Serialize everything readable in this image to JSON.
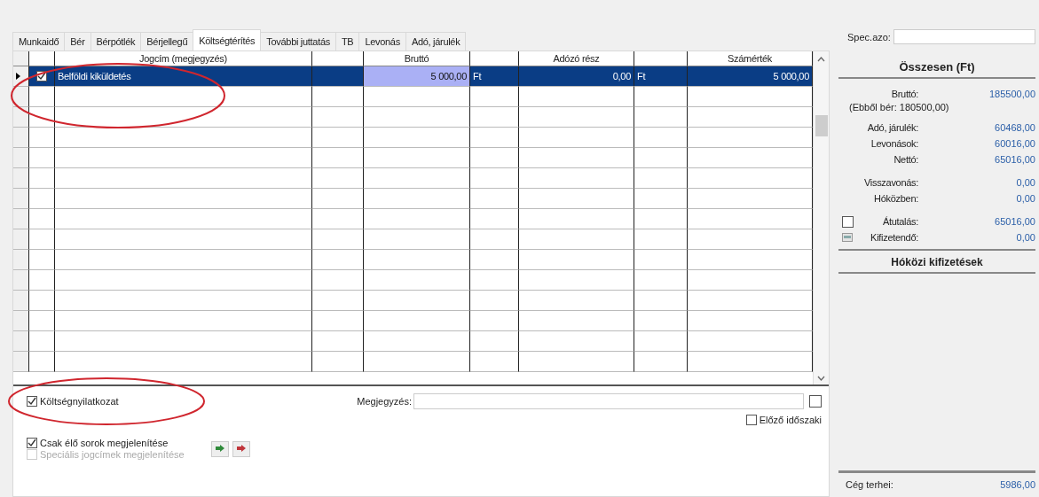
{
  "tabs": [
    {
      "label": "Munkaidő",
      "selected": false
    },
    {
      "label": "Bér",
      "selected": false
    },
    {
      "label": "Bérpótlék",
      "selected": false
    },
    {
      "label": "Bérjellegű",
      "selected": false
    },
    {
      "label": "Költségtérítés",
      "selected": true
    },
    {
      "label": "További juttatás",
      "selected": false
    },
    {
      "label": "TB",
      "selected": false
    },
    {
      "label": "Levonás",
      "selected": false
    },
    {
      "label": "Adó, járulék",
      "selected": false
    }
  ],
  "grid": {
    "header": {
      "jogcim": "Jogcím (megjegyzés)",
      "brutto": "Bruttó",
      "adozo": "Adózó rész",
      "szamertek": "Számérték"
    },
    "rows": [
      {
        "selected": true,
        "checked": true,
        "jogcim": "Belföldi kiküldetés",
        "brutto": "5 000,00",
        "brutto_unit": "Ft",
        "adozo": "0,00",
        "adozo_unit": "Ft",
        "szamertek": "5 000,00",
        "brutto_focused": true
      }
    ]
  },
  "options": {
    "koltsegnyilatkozat": {
      "label": "Költségnyilatkozat",
      "checked": true
    },
    "megjegyzes": {
      "label": "Megjegyzés:",
      "checked": false
    },
    "elozo": {
      "label": "Előző időszaki",
      "checked": false
    },
    "csak_elo": {
      "label": "Csak élő sorok megjelenítése",
      "checked": true
    },
    "specialis": {
      "label": "Speciális jogcímek megjelenítése",
      "checked": false,
      "disabled": true
    }
  },
  "side": {
    "spec_label": "Spec.azo:",
    "header": "Összesen (Ft)",
    "brutto": {
      "label": "Bruttó:",
      "value": "185500,00"
    },
    "ebbol": "(Ebből bér: 180500,00)",
    "groups": [
      [
        {
          "label": "Adó, járulék:",
          "value": "60468,00"
        },
        {
          "label": "Levonások:",
          "value": "60016,00"
        },
        {
          "label": "Nettó:",
          "value": "65016,00"
        }
      ],
      [
        {
          "label": "Visszavonás:",
          "value": "0,00"
        },
        {
          "label": "Hóközben:",
          "value": "0,00"
        }
      ],
      [
        {
          "label": "Átutalás:",
          "value": "65016,00",
          "kind": "checkbox",
          "checked": false
        },
        {
          "label": "Kifizetendő:",
          "value": "0,00",
          "kind": "icon"
        }
      ]
    ],
    "hokozi": "Hóközi kifizetések",
    "ceg": {
      "label": "Cég terhei:",
      "value": "5986,00"
    }
  }
}
